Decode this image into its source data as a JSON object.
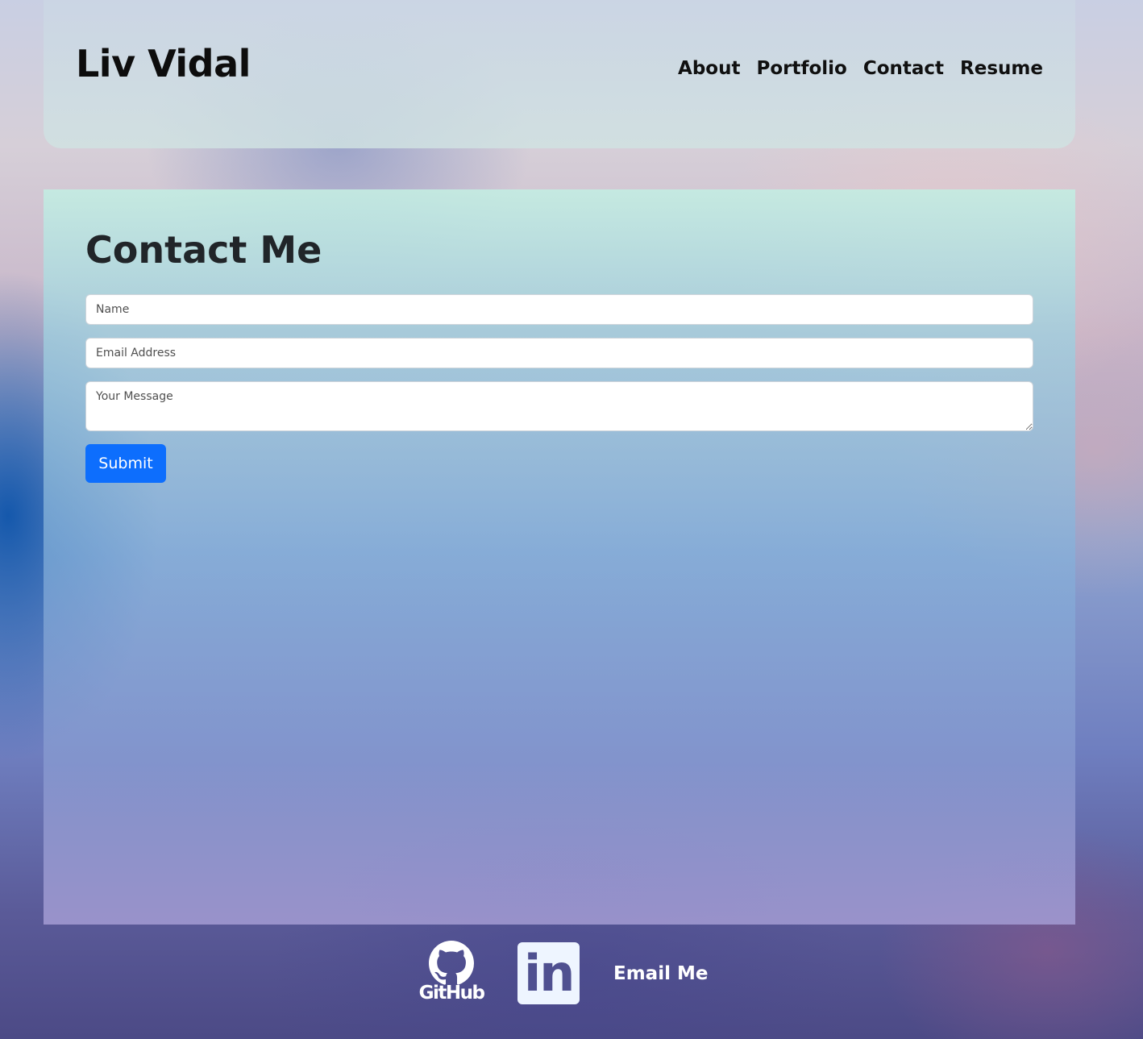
{
  "header": {
    "site_title": "Liv Vidal",
    "nav": [
      {
        "label": "About"
      },
      {
        "label": "Portfolio"
      },
      {
        "label": "Contact"
      },
      {
        "label": "Resume"
      }
    ]
  },
  "contact": {
    "heading": "Contact Me",
    "name_placeholder": "Name",
    "name_value": "",
    "email_placeholder": "Email Address",
    "email_value": "",
    "message_placeholder": "Your Message",
    "message_value": "",
    "submit_label": "Submit"
  },
  "footer": {
    "github_label": "GitHub",
    "github_icon": "github-icon",
    "linkedin_icon": "linkedin-icon",
    "linkedin_text": "in",
    "email_label": "Email Me"
  },
  "colors": {
    "primary_button": "#0d6efd",
    "heading_text": "#212529"
  }
}
